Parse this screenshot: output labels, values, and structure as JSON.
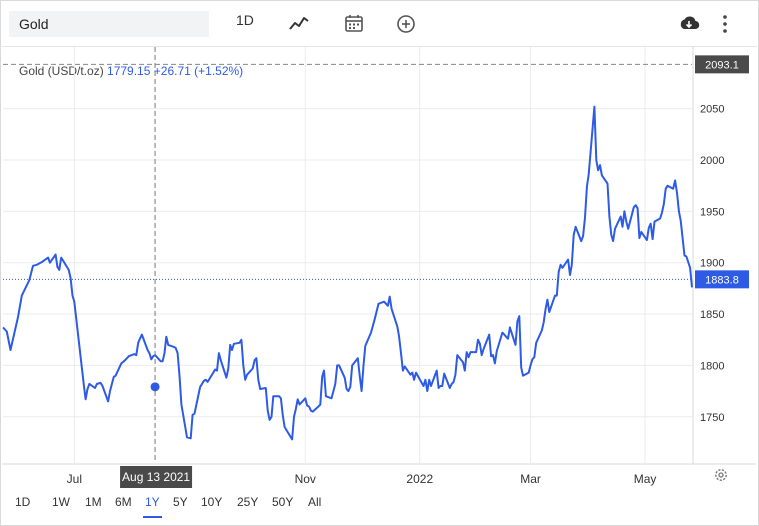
{
  "toolbar": {
    "symbol": "Gold",
    "interval": "1D",
    "icons": [
      "line-chart-icon",
      "calendar-icon",
      "plus-circle-icon",
      "download-icon",
      "more-icon"
    ]
  },
  "quote": {
    "name": "Gold (USD/t.oz)",
    "price": "1779.15",
    "change": "+26.71 (+1.52%)"
  },
  "chart_data": {
    "type": "line",
    "title": "",
    "ylim": [
      1705,
      2110
    ],
    "y_ticks": [
      1750,
      1800,
      1850,
      1900,
      1950,
      2000,
      2050
    ],
    "x_ticks": [
      {
        "label": "Jul",
        "date": "2021-07-01"
      },
      {
        "label": "Nov",
        "date": "2021-11-01"
      },
      {
        "label": "2022",
        "date": "2022-01-01"
      },
      {
        "label": "Mar",
        "date": "2022-03-01"
      },
      {
        "label": "May",
        "date": "2022-05-01"
      }
    ],
    "xlim": [
      "2021-05-24",
      "2022-05-26"
    ],
    "grid": true,
    "reference_lines": [
      {
        "label": "2093.1",
        "value": 2093.1,
        "style": "dashed"
      },
      {
        "label": "1883.8",
        "value": 1883.8,
        "style": "dotted"
      }
    ],
    "crosshair": {
      "label": "Aug 13 2021",
      "date": "2021-08-13",
      "value": 1779.15
    },
    "series": [
      {
        "color": "#2e5be6",
        "points": [
          [
            "2021-05-24",
            1837
          ],
          [
            "2021-05-26",
            1833
          ],
          [
            "2021-05-28",
            1815
          ],
          [
            "2021-06-01",
            1847
          ],
          [
            "2021-06-03",
            1868
          ],
          [
            "2021-06-07",
            1883
          ],
          [
            "2021-06-09",
            1897
          ],
          [
            "2021-06-11",
            1898
          ],
          [
            "2021-06-14",
            1901
          ],
          [
            "2021-06-17",
            1905
          ],
          [
            "2021-06-18",
            1900
          ],
          [
            "2021-06-21",
            1908
          ],
          [
            "2021-06-22",
            1896
          ],
          [
            "2021-06-23",
            1893
          ],
          [
            "2021-06-24",
            1905
          ],
          [
            "2021-06-25",
            1902
          ],
          [
            "2021-06-28",
            1893
          ],
          [
            "2021-06-29",
            1885
          ],
          [
            "2021-06-30",
            1868
          ],
          [
            "2021-07-01",
            1862
          ],
          [
            "2021-07-06",
            1782
          ],
          [
            "2021-07-07",
            1767
          ],
          [
            "2021-07-08",
            1777
          ],
          [
            "2021-07-09",
            1782
          ],
          [
            "2021-07-12",
            1778
          ],
          [
            "2021-07-13",
            1782
          ],
          [
            "2021-07-15",
            1783
          ],
          [
            "2021-07-16",
            1780
          ],
          [
            "2021-07-19",
            1765
          ],
          [
            "2021-07-20",
            1775
          ],
          [
            "2021-07-22",
            1789
          ],
          [
            "2021-07-23",
            1790
          ],
          [
            "2021-07-26",
            1802
          ],
          [
            "2021-07-28",
            1805
          ],
          [
            "2021-07-30",
            1809
          ],
          [
            "2021-08-02",
            1811
          ],
          [
            "2021-08-03",
            1810
          ],
          [
            "2021-08-04",
            1822
          ],
          [
            "2021-08-05",
            1826
          ],
          [
            "2021-08-06",
            1830
          ],
          [
            "2021-08-09",
            1815
          ],
          [
            "2021-08-10",
            1812
          ],
          [
            "2021-08-11",
            1806
          ],
          [
            "2021-08-12",
            1809
          ],
          [
            "2021-08-13",
            1810
          ],
          [
            "2021-08-16",
            1804
          ],
          [
            "2021-08-17",
            1804
          ],
          [
            "2021-08-18",
            1812
          ],
          [
            "2021-08-19",
            1828
          ],
          [
            "2021-08-20",
            1820
          ],
          [
            "2021-08-23",
            1818
          ],
          [
            "2021-08-24",
            1817
          ],
          [
            "2021-08-25",
            1812
          ],
          [
            "2021-08-26",
            1790
          ],
          [
            "2021-08-27",
            1762
          ],
          [
            "2021-08-30",
            1730
          ],
          [
            "2021-09-01",
            1729
          ],
          [
            "2021-09-02",
            1752
          ],
          [
            "2021-09-03",
            1753
          ],
          [
            "2021-09-06",
            1779
          ],
          [
            "2021-09-08",
            1785
          ],
          [
            "2021-09-09",
            1786
          ],
          [
            "2021-09-10",
            1784
          ],
          [
            "2021-09-13",
            1793
          ],
          [
            "2021-09-14",
            1796
          ],
          [
            "2021-09-15",
            1795
          ],
          [
            "2021-09-16",
            1812
          ],
          [
            "2021-09-17",
            1805
          ],
          [
            "2021-09-20",
            1788
          ],
          [
            "2021-09-21",
            1797
          ],
          [
            "2021-09-22",
            1820
          ],
          [
            "2021-09-23",
            1815
          ],
          [
            "2021-09-24",
            1821
          ],
          [
            "2021-09-27",
            1822
          ],
          [
            "2021-09-28",
            1825
          ],
          [
            "2021-09-29",
            1800
          ],
          [
            "2021-09-30",
            1786
          ],
          [
            "2021-10-01",
            1791
          ],
          [
            "2021-10-04",
            1797
          ],
          [
            "2021-10-05",
            1805
          ],
          [
            "2021-10-06",
            1807
          ],
          [
            "2021-10-07",
            1786
          ],
          [
            "2021-10-08",
            1777
          ],
          [
            "2021-10-11",
            1778
          ],
          [
            "2021-10-12",
            1756
          ],
          [
            "2021-10-13",
            1747
          ],
          [
            "2021-10-14",
            1750
          ],
          [
            "2021-10-15",
            1770
          ],
          [
            "2021-10-18",
            1770
          ],
          [
            "2021-10-19",
            1768
          ],
          [
            "2021-10-20",
            1752
          ],
          [
            "2021-10-21",
            1740
          ],
          [
            "2021-10-22",
            1737
          ],
          [
            "2021-10-25",
            1728
          ],
          [
            "2021-10-26",
            1750
          ],
          [
            "2021-10-27",
            1758
          ],
          [
            "2021-10-28",
            1767
          ],
          [
            "2021-10-29",
            1762
          ],
          [
            "2021-11-01",
            1768
          ],
          [
            "2021-11-02",
            1761
          ],
          [
            "2021-11-03",
            1760
          ],
          [
            "2021-11-04",
            1756
          ],
          [
            "2021-11-05",
            1755
          ],
          [
            "2021-11-08",
            1760
          ],
          [
            "2021-11-09",
            1762
          ],
          [
            "2021-11-10",
            1789
          ],
          [
            "2021-11-11",
            1795
          ],
          [
            "2021-11-12",
            1770
          ],
          [
            "2021-11-15",
            1768
          ],
          [
            "2021-11-16",
            1775
          ],
          [
            "2021-11-17",
            1782
          ],
          [
            "2021-11-18",
            1800
          ],
          [
            "2021-11-19",
            1800
          ],
          [
            "2021-11-22",
            1788
          ],
          [
            "2021-11-23",
            1777
          ],
          [
            "2021-11-24",
            1775
          ],
          [
            "2021-11-25",
            1779
          ],
          [
            "2021-11-26",
            1800
          ],
          [
            "2021-11-29",
            1807
          ],
          [
            "2021-11-30",
            1790
          ],
          [
            "2021-12-01",
            1775
          ],
          [
            "2021-12-02",
            1800
          ],
          [
            "2021-12-03",
            1819
          ],
          [
            "2021-12-06",
            1832
          ],
          [
            "2021-12-08",
            1845
          ],
          [
            "2021-12-10",
            1860
          ],
          [
            "2021-12-13",
            1862
          ],
          [
            "2021-12-15",
            1858
          ],
          [
            "2021-12-16",
            1867
          ],
          [
            "2021-12-17",
            1855
          ],
          [
            "2021-12-20",
            1838
          ],
          [
            "2021-12-21",
            1828
          ],
          [
            "2021-12-22",
            1812
          ],
          [
            "2021-12-23",
            1795
          ],
          [
            "2021-12-24",
            1799
          ],
          [
            "2021-12-27",
            1791
          ],
          [
            "2021-12-28",
            1793
          ],
          [
            "2021-12-29",
            1786
          ],
          [
            "2021-12-30",
            1793
          ],
          [
            "2022-01-03",
            1780
          ],
          [
            "2022-01-04",
            1786
          ],
          [
            "2022-01-05",
            1775
          ],
          [
            "2022-01-06",
            1786
          ],
          [
            "2022-01-07",
            1780
          ],
          [
            "2022-01-10",
            1795
          ],
          [
            "2022-01-11",
            1778
          ],
          [
            "2022-01-12",
            1780
          ],
          [
            "2022-01-13",
            1780
          ],
          [
            "2022-01-14",
            1792
          ],
          [
            "2022-01-17",
            1778
          ],
          [
            "2022-01-18",
            1782
          ],
          [
            "2022-01-19",
            1784
          ],
          [
            "2022-01-20",
            1791
          ],
          [
            "2022-01-21",
            1810
          ],
          [
            "2022-01-24",
            1803
          ],
          [
            "2022-01-25",
            1795
          ],
          [
            "2022-01-26",
            1813
          ],
          [
            "2022-01-27",
            1808
          ],
          [
            "2022-01-28",
            1813
          ],
          [
            "2022-01-31",
            1813
          ],
          [
            "2022-02-01",
            1825
          ],
          [
            "2022-02-02",
            1821
          ],
          [
            "2022-02-03",
            1810
          ],
          [
            "2022-02-04",
            1816
          ],
          [
            "2022-02-07",
            1830
          ],
          [
            "2022-02-08",
            1809
          ],
          [
            "2022-02-09",
            1810
          ],
          [
            "2022-02-10",
            1802
          ],
          [
            "2022-02-11",
            1814
          ],
          [
            "2022-02-14",
            1832
          ],
          [
            "2022-02-15",
            1830
          ],
          [
            "2022-02-16",
            1828
          ],
          [
            "2022-02-17",
            1826
          ],
          [
            "2022-02-18",
            1837
          ],
          [
            "2022-02-21",
            1820
          ],
          [
            "2022-02-22",
            1843
          ],
          [
            "2022-02-23",
            1848
          ],
          [
            "2022-02-24",
            1798
          ],
          [
            "2022-02-25",
            1790
          ],
          [
            "2022-02-28",
            1793
          ],
          [
            "2022-03-01",
            1800
          ],
          [
            "2022-03-02",
            1806
          ],
          [
            "2022-03-03",
            1808
          ],
          [
            "2022-03-04",
            1822
          ],
          [
            "2022-03-07",
            1834
          ],
          [
            "2022-03-08",
            1842
          ],
          [
            "2022-03-09",
            1855
          ],
          [
            "2022-03-10",
            1864
          ],
          [
            "2022-03-11",
            1852
          ],
          [
            "2022-03-14",
            1868
          ],
          [
            "2022-03-15",
            1868
          ],
          [
            "2022-03-16",
            1891
          ],
          [
            "2022-03-17",
            1898
          ],
          [
            "2022-03-18",
            1895
          ],
          [
            "2022-03-21",
            1903
          ],
          [
            "2022-03-22",
            1888
          ],
          [
            "2022-03-23",
            1898
          ],
          [
            "2022-03-24",
            1927
          ],
          [
            "2022-03-25",
            1935
          ],
          [
            "2022-03-28",
            1921
          ],
          [
            "2022-03-29",
            1926
          ],
          [
            "2022-03-30",
            1944
          ],
          [
            "2022-03-31",
            1974
          ],
          [
            "2022-04-01",
            1986
          ],
          [
            "2022-04-04",
            2052
          ],
          [
            "2022-04-05",
            2000
          ],
          [
            "2022-04-06",
            1990
          ],
          [
            "2022-04-07",
            1995
          ],
          [
            "2022-04-08",
            1985
          ],
          [
            "2022-04-11",
            1977
          ],
          [
            "2022-04-12",
            1945
          ],
          [
            "2022-04-13",
            1927
          ],
          [
            "2022-04-14",
            1921
          ],
          [
            "2022-04-15",
            1933
          ],
          [
            "2022-04-18",
            1945
          ],
          [
            "2022-04-19",
            1935
          ],
          [
            "2022-04-20",
            1950
          ],
          [
            "2022-04-21",
            1940
          ],
          [
            "2022-04-22",
            1933
          ],
          [
            "2022-04-25",
            1954
          ],
          [
            "2022-04-26",
            1956
          ],
          [
            "2022-04-27",
            1953
          ],
          [
            "2022-04-28",
            1924
          ],
          [
            "2022-04-29",
            1930
          ],
          [
            "2022-05-02",
            1922
          ],
          [
            "2022-05-03",
            1934
          ],
          [
            "2022-05-04",
            1938
          ],
          [
            "2022-05-05",
            1923
          ],
          [
            "2022-05-06",
            1940
          ],
          [
            "2022-05-09",
            1943
          ],
          [
            "2022-05-10",
            1949
          ],
          [
            "2022-05-11",
            1957
          ],
          [
            "2022-05-12",
            1972
          ],
          [
            "2022-05-13",
            1975
          ],
          [
            "2022-05-16",
            1972
          ],
          [
            "2022-05-17",
            1980
          ],
          [
            "2022-05-18",
            1968
          ],
          [
            "2022-05-19",
            1950
          ],
          [
            "2022-05-20",
            1941
          ],
          [
            "2022-05-22",
            1907
          ],
          [
            "2022-05-23",
            1906
          ],
          [
            "2022-05-25",
            1895
          ],
          [
            "2022-05-26",
            1876
          ]
        ]
      }
    ]
  },
  "y_axis_labels": [
    "1750",
    "1800",
    "1850",
    "1900",
    "1950",
    "2000",
    "2050"
  ],
  "last_price_label": "1883.8",
  "max_label": "2093.1",
  "crosshair_label": "Aug 13 2021",
  "x_axis_labels": [
    "Jul",
    "Nov",
    "2022",
    "Mar",
    "May"
  ],
  "ranges": [
    {
      "label": "1D"
    },
    {
      "label": "1W"
    },
    {
      "label": "1M"
    },
    {
      "label": "6M"
    },
    {
      "label": "1Y",
      "active": true
    },
    {
      "label": "5Y"
    },
    {
      "label": "10Y"
    },
    {
      "label": "25Y"
    },
    {
      "label": "50Y"
    },
    {
      "label": "All"
    }
  ]
}
